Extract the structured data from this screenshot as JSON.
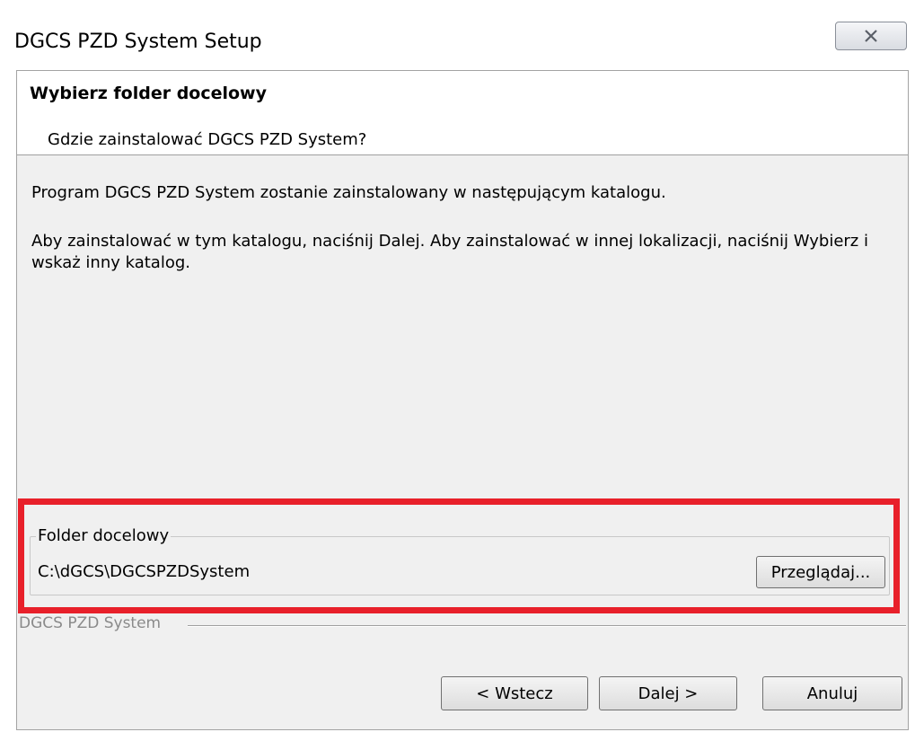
{
  "window": {
    "title": "DGCS PZD System Setup",
    "close_icon": "close-icon"
  },
  "header": {
    "title": "Wybierz folder docelowy",
    "subtitle": "Gdzie zainstalować DGCS PZD System?"
  },
  "body": {
    "line1": "Program DGCS PZD System zostanie zainstalowany w następującym katalogu.",
    "line2": "Aby zainstalować w tym katalogu, naciśnij Dalej.  Aby zainstalować w innej lokalizacji, naciśnij Wybierz i wskaż inny katalog."
  },
  "folder_group": {
    "legend": "Folder docelowy",
    "path": "C:\\dGCS\\DGCSPZDSystem",
    "browse_label": "Przeglądaj..."
  },
  "branding": {
    "text": "DGCS PZD System"
  },
  "buttons": {
    "back_label": "< Wstecz",
    "next_label": "Dalej >",
    "cancel_label": "Anuluj"
  },
  "colors": {
    "highlight": "#e8202a",
    "dialog_bg": "#f0f0f0"
  }
}
